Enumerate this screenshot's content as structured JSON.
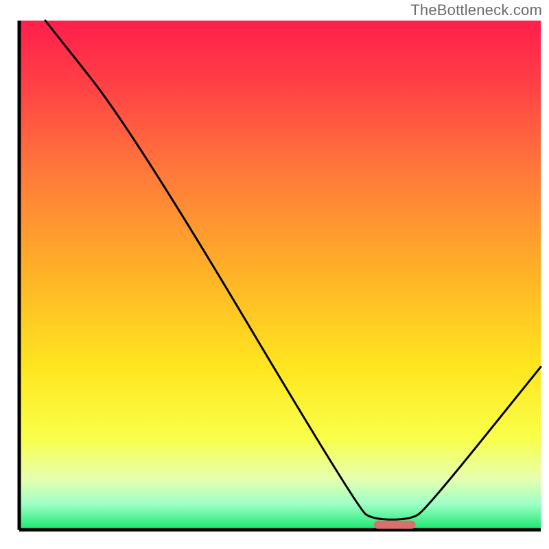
{
  "watermark": "TheBottleneck.com",
  "chart_data": {
    "type": "line",
    "title": "",
    "xlabel": "",
    "ylabel": "",
    "xlim": [
      0,
      100
    ],
    "ylim": [
      0,
      100
    ],
    "grid": false,
    "legend": false,
    "curve_points": [
      {
        "x": 5,
        "y": 100
      },
      {
        "x": 22,
        "y": 78
      },
      {
        "x": 65,
        "y": 4
      },
      {
        "x": 68,
        "y": 2
      },
      {
        "x": 75,
        "y": 2
      },
      {
        "x": 78,
        "y": 4
      },
      {
        "x": 100,
        "y": 32
      }
    ],
    "optimal_marker": {
      "x_start": 68,
      "x_end": 76,
      "y": 1
    },
    "gradient_stops": [
      {
        "pct": 0,
        "color": "#ff1e4b"
      },
      {
        "pct": 12,
        "color": "#ff3f46"
      },
      {
        "pct": 30,
        "color": "#ff7a3a"
      },
      {
        "pct": 50,
        "color": "#ffb327"
      },
      {
        "pct": 68,
        "color": "#ffe61f"
      },
      {
        "pct": 82,
        "color": "#f9ff4a"
      },
      {
        "pct": 90,
        "color": "#e6ffb0"
      },
      {
        "pct": 95,
        "color": "#9dffc6"
      },
      {
        "pct": 100,
        "color": "#17e86b"
      }
    ],
    "colors": {
      "axis": "#000000",
      "curve": "#000000",
      "marker": "#d9706e",
      "background": "#ffffff"
    }
  }
}
